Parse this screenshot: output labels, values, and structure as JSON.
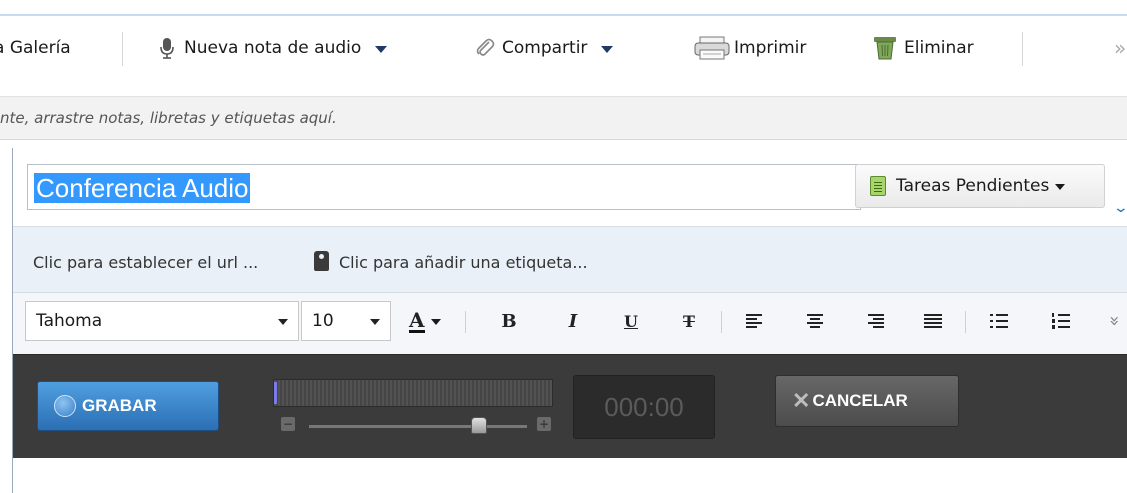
{
  "toolbar": {
    "gallery_label": "a Galería",
    "new_audio_label": "Nueva nota de audio",
    "share_label": "Compartir",
    "print_label": "Imprimir",
    "delete_label": "Eliminar",
    "more_glyph": "»"
  },
  "shortcuts_hint": "nte, arrastre notas, libretas y etiquetas aquí.",
  "note": {
    "title": "Conferencia Audio",
    "notebook": "Tareas Pendientes",
    "url_placeholder": "Clic para establecer el url ...",
    "tag_placeholder": "Clic para añadir una etiqueta..."
  },
  "format": {
    "font": "Tahoma",
    "size": "10",
    "bold": "B",
    "italic": "I",
    "underline": "U",
    "strike": "T",
    "font_color_glyph": "A",
    "more_glyph": "»"
  },
  "audio": {
    "record_label": "GRABAR",
    "timer": "000:00",
    "cancel_label": "CANCELAR",
    "volume_level": 0.78,
    "input_level": 0.01
  },
  "colors": {
    "selection": "#3399ff",
    "record_button": "#3b86cc",
    "audio_bar": "#3b3b3b"
  }
}
